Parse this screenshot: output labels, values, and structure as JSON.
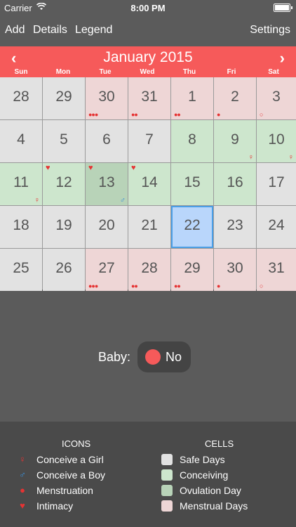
{
  "status": {
    "carrier": "Carrier",
    "time": "8:00 PM",
    "battery_level": 1.0
  },
  "toolbar": {
    "add": "Add",
    "details": "Details",
    "legend": "Legend",
    "settings": "Settings"
  },
  "calendar": {
    "month": "January 2015",
    "prev": "‹",
    "next": "›",
    "weekdays": [
      "Sun",
      "Mon",
      "Tue",
      "Wed",
      "Thu",
      "Fri",
      "Sat"
    ],
    "weeks": [
      [
        {
          "day": "28",
          "type": "safe"
        },
        {
          "day": "29",
          "type": "safe"
        },
        {
          "day": "30",
          "type": "menstrual",
          "drops": "●●●"
        },
        {
          "day": "31",
          "type": "menstrual",
          "drops": "●●"
        },
        {
          "day": "1",
          "type": "menstrual",
          "drops": "●●"
        },
        {
          "day": "2",
          "type": "menstrual",
          "drops": "●"
        },
        {
          "day": "3",
          "type": "menstrual",
          "drops": "○"
        }
      ],
      [
        {
          "day": "4",
          "type": "safe"
        },
        {
          "day": "5",
          "type": "safe"
        },
        {
          "day": "6",
          "type": "safe"
        },
        {
          "day": "7",
          "type": "safe"
        },
        {
          "day": "8",
          "type": "conceiving"
        },
        {
          "day": "9",
          "type": "conceiving",
          "sym": "♀",
          "sym_type": "girl"
        },
        {
          "day": "10",
          "type": "conceiving",
          "sym": "♀",
          "sym_type": "girl"
        }
      ],
      [
        {
          "day": "11",
          "type": "conceiving",
          "sym": "♀",
          "sym_type": "girl"
        },
        {
          "day": "12",
          "type": "conceiving",
          "heart": "♥"
        },
        {
          "day": "13",
          "type": "ovulation",
          "heart": "♥",
          "sym": "♂",
          "sym_type": "boy"
        },
        {
          "day": "14",
          "type": "conceiving",
          "heart": "♥"
        },
        {
          "day": "15",
          "type": "conceiving"
        },
        {
          "day": "16",
          "type": "conceiving"
        },
        {
          "day": "17",
          "type": "safe"
        }
      ],
      [
        {
          "day": "18",
          "type": "safe"
        },
        {
          "day": "19",
          "type": "safe"
        },
        {
          "day": "20",
          "type": "safe"
        },
        {
          "day": "21",
          "type": "safe"
        },
        {
          "day": "22",
          "type": "selected"
        },
        {
          "day": "23",
          "type": "safe"
        },
        {
          "day": "24",
          "type": "safe"
        }
      ],
      [
        {
          "day": "25",
          "type": "safe"
        },
        {
          "day": "26",
          "type": "safe"
        },
        {
          "day": "27",
          "type": "menstrual",
          "drops": "●●●"
        },
        {
          "day": "28",
          "type": "menstrual",
          "drops": "●●"
        },
        {
          "day": "29",
          "type": "menstrual",
          "drops": "●●"
        },
        {
          "day": "30",
          "type": "menstrual",
          "drops": "●"
        },
        {
          "day": "31",
          "type": "menstrual",
          "drops": "○"
        }
      ]
    ]
  },
  "baby": {
    "label": "Baby:",
    "value": "No"
  },
  "legend": {
    "icons_title": "ICONS",
    "cells_title": "CELLS",
    "icons": [
      {
        "symbol": "♀",
        "label": "Conceive a Girl",
        "color": "#e53333"
      },
      {
        "symbol": "♂",
        "label": "Conceive a Boy",
        "color": "#3a8fd8"
      },
      {
        "symbol": "●",
        "label": "Menstruation",
        "color": "#e53333"
      },
      {
        "symbol": "♥",
        "label": "Intimacy",
        "color": "#e53333"
      }
    ],
    "cells": [
      {
        "label": "Safe Days",
        "color": "#e2e2e2"
      },
      {
        "label": "Conceiving",
        "color": "#cde6cd"
      },
      {
        "label": "Ovulation Day",
        "color": "#b8d3b8"
      },
      {
        "label": "Menstrual Days",
        "color": "#eed6d6"
      }
    ]
  },
  "colors": {
    "safe": "#e2e2e2",
    "conceiving": "#cde6cd",
    "ovulation": "#b8d3b8",
    "menstrual": "#eed6d6",
    "selected": "#b9d6fb",
    "accent": "#f65a5a"
  }
}
